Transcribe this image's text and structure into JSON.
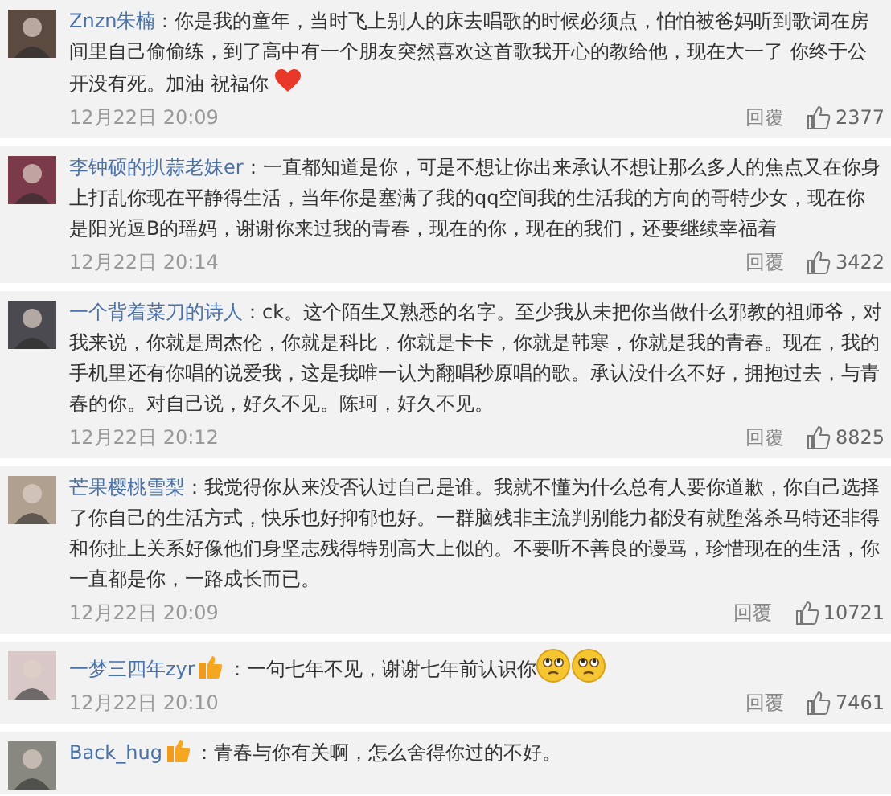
{
  "comments": [
    {
      "user": "Znzn朱楠",
      "text": "：你是我的童年，当时飞上别人的床去唱歌的时候必须点，怕怕被爸妈听到歌词在房间里自己偷偷练，到了高中有一个朋友突然喜欢这首歌我开心的教给他，现在大一了 你终于公开没有死。加油 祝福你",
      "emoticons": [
        {
          "kind": "heart"
        }
      ],
      "time": "12月22日 20:09",
      "reply": "回覆",
      "likes": "2377"
    },
    {
      "user": "李钟硕的扒蒜老妹er",
      "text": "：一直都知道是你，可是不想让你出来承认不想让那么多人的焦点又在你身上打乱你现在平静得生活，当年你是塞满了我的qq空间我的生活我的方向的哥特少女，现在你是阳光逗B的瑶妈，谢谢你来过我的青春，现在的你，现在的我们，还要继续幸福着",
      "time": "12月22日 20:14",
      "reply": "回覆",
      "likes": "3422"
    },
    {
      "user": "一个背着菜刀的诗人",
      "text": "：ck。这个陌生又熟悉的名字。至少我从未把你当做什么邪教的祖师爷，对我来说，你就是周杰伦，你就是科比，你就是卡卡，你就是韩寒，你就是我的青春。现在，我的手机里还有你唱的说爱我，这是我唯一认为翻唱秒原唱的歌。承认没什么不好，拥抱过去，与青春的你。对自己说，好久不见。陈珂，好久不见。",
      "time": "12月22日 20:12",
      "reply": "回覆",
      "likes": "8825"
    },
    {
      "user": "芒果樱桃雪梨",
      "text": "：我觉得你从来没否认过自己是谁。我就不懂为什么总有人要你道歉，你自己选择了你自己的生活方式，快乐也好抑郁也好。一群脑残非主流判别能力都没有就堕落杀马特还非得和你扯上关系好像他们身坚志残得特别高大上似的。不要听不善良的谩骂，珍惜现在的生活，你一直都是你，一路成长而已。",
      "time": "12月22日 20:09",
      "reply": "回覆",
      "likes": "10721"
    },
    {
      "user": "一梦三四年zyr",
      "badge": true,
      "text": "：一句七年不见，谢谢七年前认识你",
      "emoticons": [
        {
          "kind": "sad-face"
        },
        {
          "kind": "sad-face"
        }
      ],
      "time": "12月22日 20:10",
      "reply": "回覆",
      "likes": "7461"
    },
    {
      "user": "Back_hug",
      "badge": true,
      "text": "：青春与你有关啊，怎么舍得你过的不好。"
    }
  ]
}
